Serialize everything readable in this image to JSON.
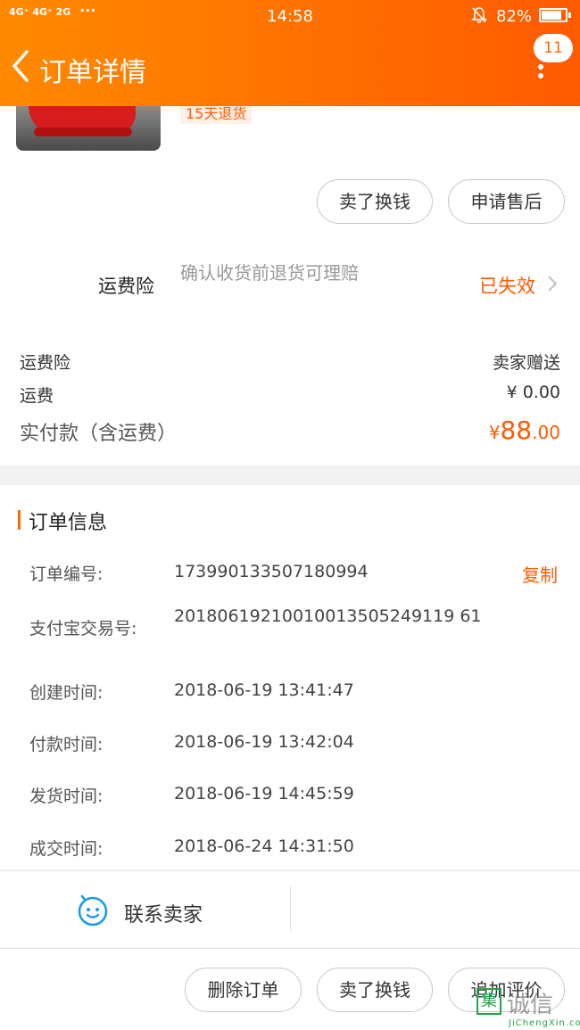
{
  "status_bar": {
    "signal": "4G⁺ 4G⁺ 2G",
    "dots": "···",
    "time": "14:58",
    "battery": "82%",
    "battery_level": 0.82
  },
  "header": {
    "title": "订单详情",
    "badge": "11"
  },
  "product": {
    "tag": "15天退货"
  },
  "actions_top": {
    "sell_button": "卖了换钱",
    "after_sale_button": "申请售后"
  },
  "insurance": {
    "label": "运费险",
    "description": "确认收货前退货可理赔",
    "status": "已失效"
  },
  "summary": {
    "insurance_label": "运费险",
    "insurance_value": "卖家赠送",
    "shipping_label": "运费",
    "shipping_value": "¥ 0.00",
    "total_label": "实付款（含运费）",
    "total_currency": "¥",
    "total_int": "88",
    "total_dec": ".00"
  },
  "order_info": {
    "title": "订单信息",
    "copy_label": "复制",
    "rows": [
      {
        "label": "订单编号:",
        "value": "173990133507180994"
      },
      {
        "label": "支付宝交易号:",
        "value": "20180619210010013505249119 61"
      },
      {
        "label": "创建时间:",
        "value": "2018-06-19 13:41:47"
      },
      {
        "label": "付款时间:",
        "value": "2018-06-19 13:42:04"
      },
      {
        "label": "发货时间:",
        "value": "2018-06-19 14:45:59"
      },
      {
        "label": "成交时间:",
        "value": "2018-06-24 14:31:50"
      }
    ]
  },
  "contact": {
    "label": "联系卖家"
  },
  "actions_bottom": {
    "delete_button": "删除订单",
    "sell_button": "卖了换钱",
    "review_button": "追加评价"
  },
  "watermark": {
    "brand": "诚信",
    "box_char": "集",
    "url": "JiChengXin.com"
  },
  "colors": {
    "accent": "#ff5a00",
    "header_start": "#ff8a00",
    "header_end": "#ff5a00"
  }
}
